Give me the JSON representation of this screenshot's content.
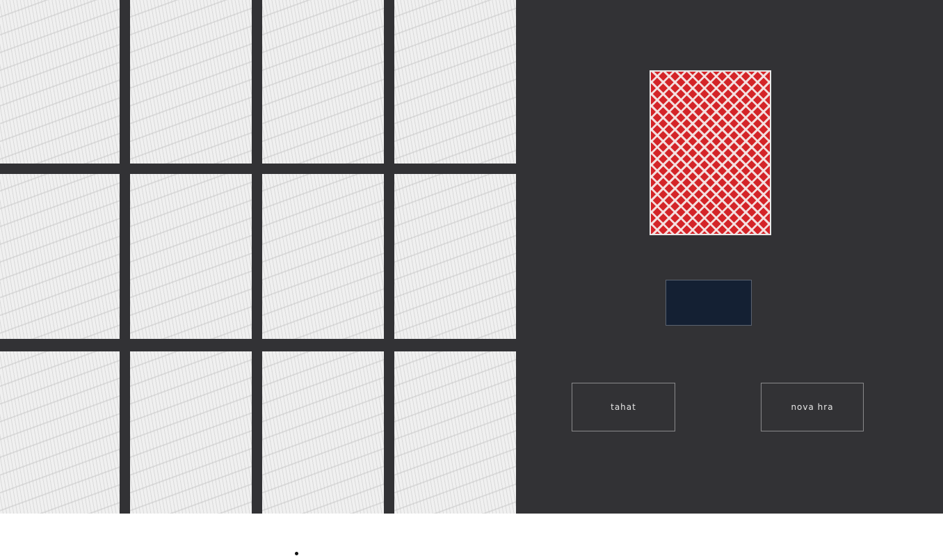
{
  "game": {
    "board_cards": [
      {
        "id": "card-r1-c1"
      },
      {
        "id": "card-r1-c2"
      },
      {
        "id": "card-r1-c3"
      },
      {
        "id": "card-r1-c4"
      },
      {
        "id": "card-r2-c1"
      },
      {
        "id": "card-r2-c2"
      },
      {
        "id": "card-r2-c3"
      },
      {
        "id": "card-r2-c4"
      },
      {
        "id": "card-r3-c1"
      },
      {
        "id": "card-r3-c2"
      },
      {
        "id": "card-r3-c3"
      },
      {
        "id": "card-r3-c4"
      }
    ],
    "deck": {
      "back_color": "#d42428",
      "pattern_color": "#f5e6e6"
    },
    "score_display": {
      "value": ""
    },
    "buttons": {
      "draw_label": "tahat",
      "new_game_label": "nova hra"
    }
  },
  "colors": {
    "background": "#323235",
    "card_back": "#f0f0f0",
    "score_box": "#142033",
    "page": "#ffffff"
  }
}
